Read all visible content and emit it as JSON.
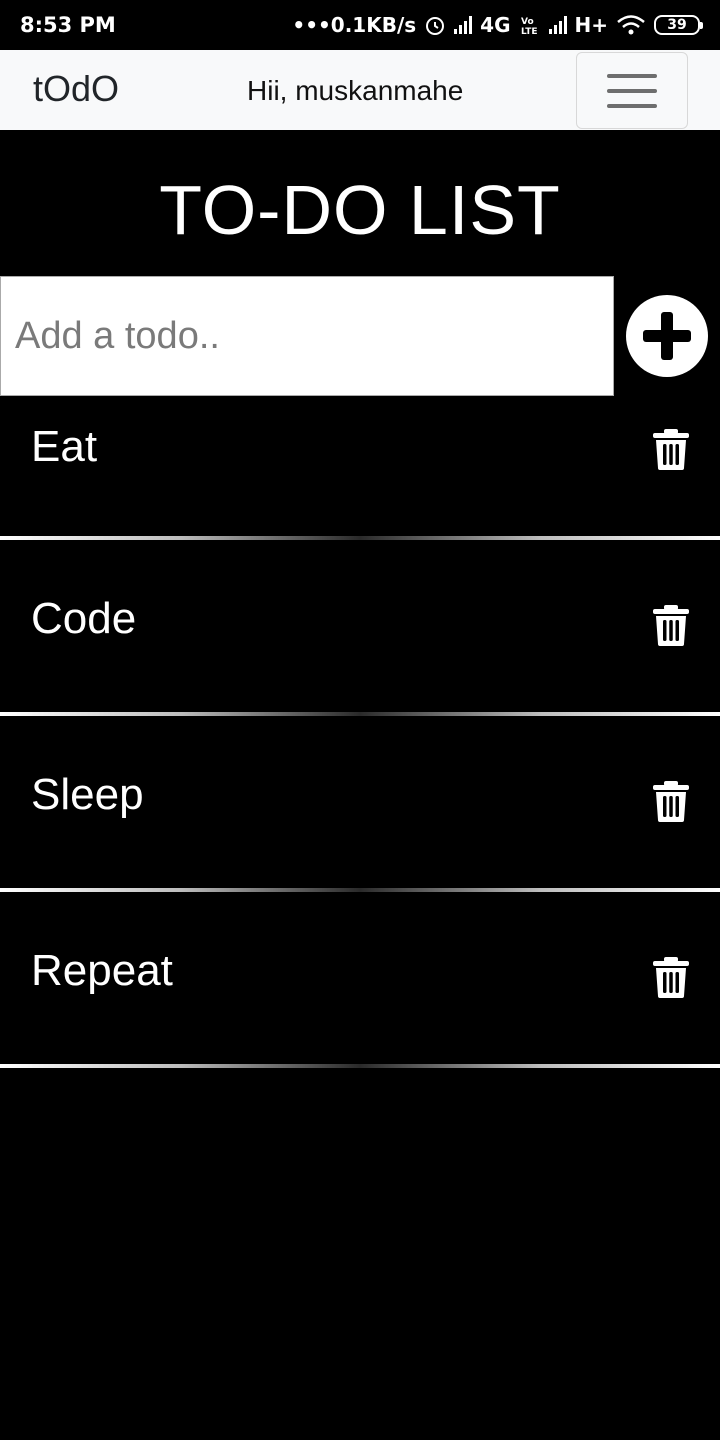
{
  "status_bar": {
    "time": "8:53 PM",
    "speed": "•••0.1KB/s",
    "network_4g": "4G",
    "network_h": "H+",
    "battery": "39"
  },
  "navbar": {
    "brand": "tOdO",
    "greeting": "Hii, muskanmahe"
  },
  "page": {
    "title": "TO-DO LIST",
    "input_placeholder": "Add a todo.."
  },
  "todos": [
    {
      "text": "Eat"
    },
    {
      "text": "Code"
    },
    {
      "text": "Sleep"
    },
    {
      "text": "Repeat"
    }
  ],
  "icons": {
    "add": "plus-circle-icon",
    "delete": "trash-icon",
    "menu": "hamburger-icon"
  },
  "colors": {
    "background": "#000000",
    "navbar": "#f8f9fa",
    "text": "#ffffff"
  }
}
